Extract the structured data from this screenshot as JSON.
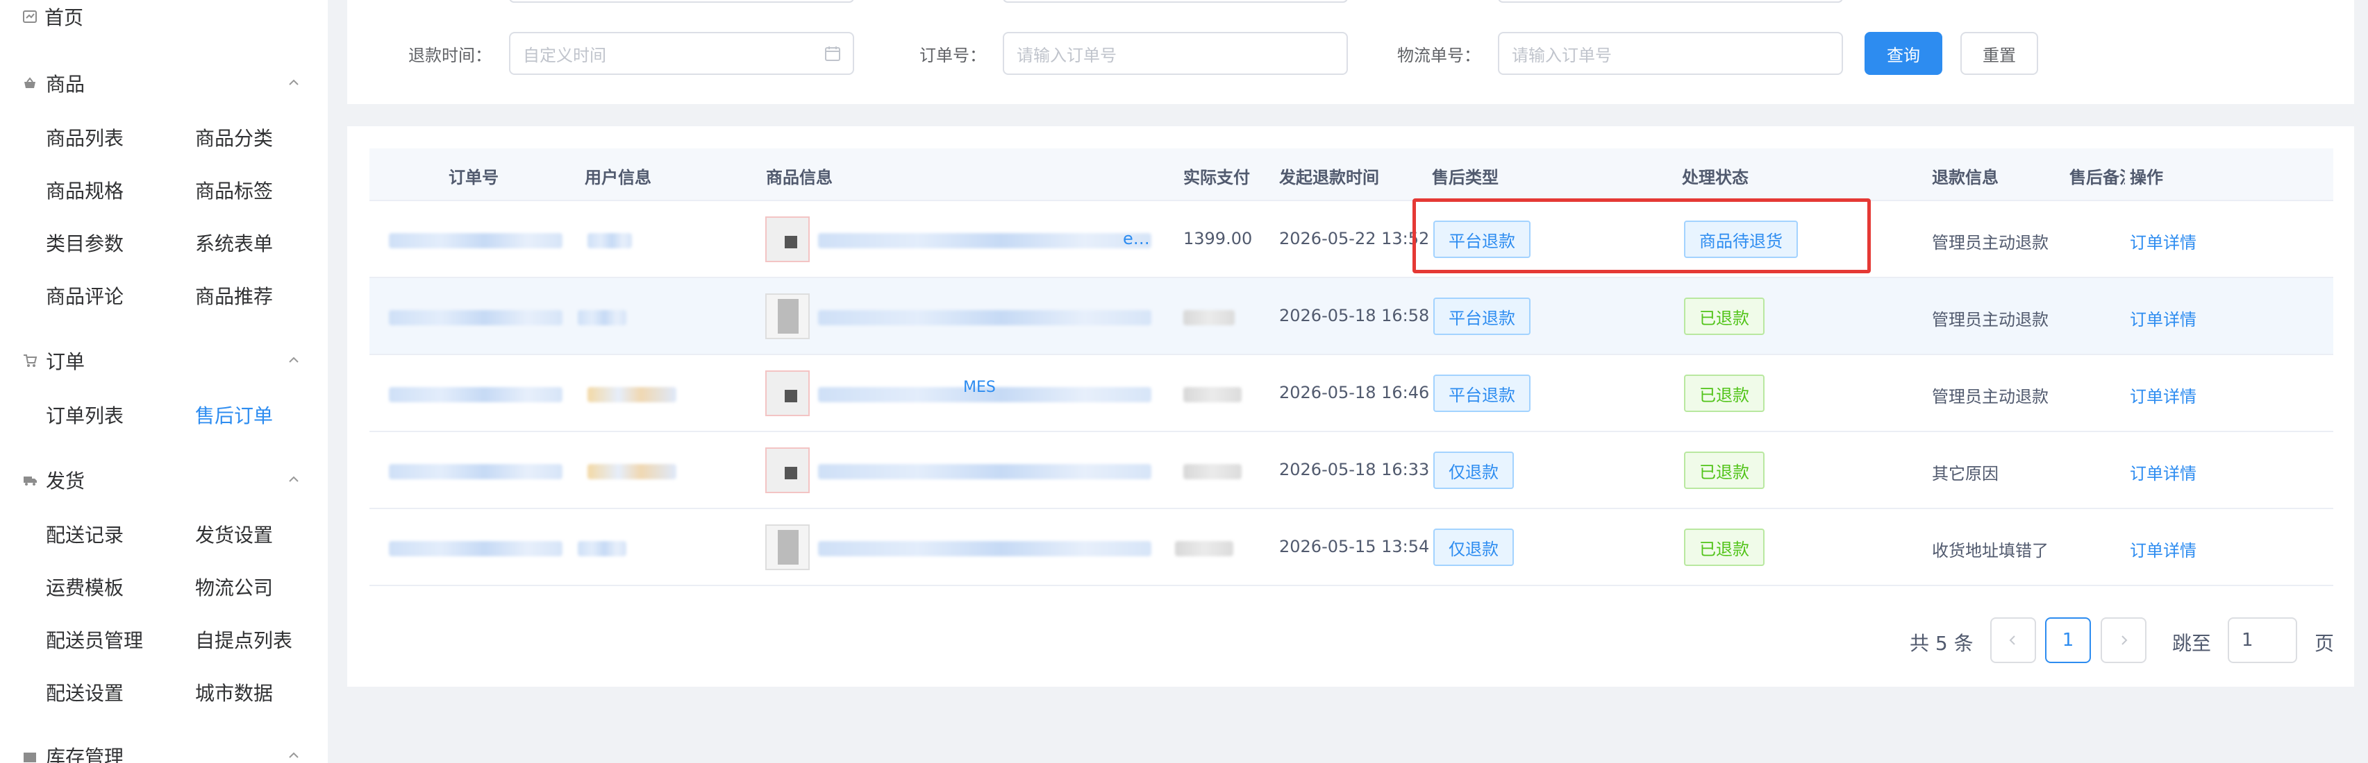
{
  "sidebar": {
    "home": "首页",
    "sections": [
      {
        "label": "商品",
        "items": [
          "商品列表",
          "商品分类",
          "商品规格",
          "商品标签",
          "类目参数",
          "系统表单",
          "商品评论",
          "商品推荐"
        ]
      },
      {
        "label": "订单",
        "items": [
          "订单列表",
          "售后订单"
        ]
      },
      {
        "label": "发货",
        "items": [
          "配送记录",
          "发货设置",
          "运费模板",
          "物流公司",
          "配送员管理",
          "自提点列表",
          "配送设置",
          "城市数据"
        ]
      },
      {
        "label": "库存管理",
        "items": []
      }
    ],
    "active_item": "售后订单"
  },
  "filters": {
    "refund_time_label": "退款时间：",
    "refund_time_placeholder": "自定义时间",
    "order_no_label": "订单号：",
    "order_no_placeholder": "请输入订单号",
    "tracking_no_label": "物流单号：",
    "tracking_no_placeholder": "请输入订单号",
    "query_button": "查询",
    "reset_button": "重置"
  },
  "table": {
    "columns": [
      "订单号",
      "用户信息",
      "商品信息",
      "实际支付",
      "发起退款时间",
      "售后类型",
      "处理状态",
      "退款信息",
      "售后备注",
      "操作"
    ],
    "rows": [
      {
        "paid": "1399.00",
        "product_tail": "e…",
        "time": "2026-05-22 13:52",
        "type": "平台退款",
        "status": "商品待退货",
        "refund_info": "管理员主动退款",
        "action": "订单详情"
      },
      {
        "paid": "",
        "product_tail": "",
        "time": "2026-05-18 16:58",
        "type": "平台退款",
        "status": "已退款",
        "refund_info": "管理员主动退款",
        "action": "订单详情"
      },
      {
        "paid": "",
        "product_tail": "MES",
        "time": "2026-05-18 16:46",
        "type": "平台退款",
        "status": "已退款",
        "refund_info": "管理员主动退款",
        "action": "订单详情"
      },
      {
        "paid": "",
        "product_tail": "",
        "time": "2026-05-18 16:33",
        "type": "仅退款",
        "status": "已退款",
        "refund_info": "其它原因",
        "action": "订单详情"
      },
      {
        "paid": "",
        "product_tail": "",
        "time": "2026-05-15 13:54",
        "type": "仅退款",
        "status": "已退款",
        "refund_info": "收货地址填错了",
        "action": "订单详情"
      }
    ]
  },
  "pagination": {
    "total_text": "共 5 条",
    "current_page": "1",
    "jump_label": "跳至",
    "jump_value": "1",
    "page_suffix": "页"
  },
  "colors": {
    "primary": "#2d8cf0",
    "success": "#52c41a",
    "highlight_box": "#e53935"
  }
}
